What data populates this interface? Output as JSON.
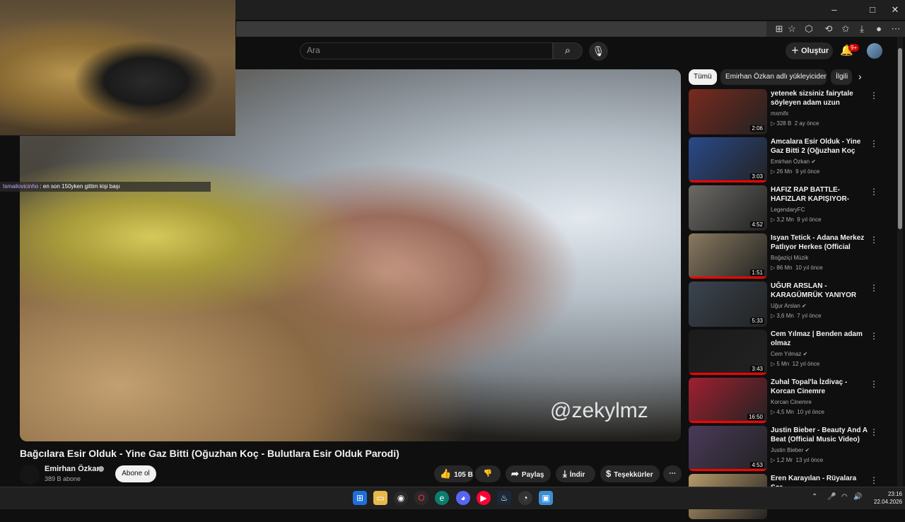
{
  "browser": {
    "controls": [
      "–",
      "□",
      "✕"
    ]
  },
  "header": {
    "search_placeholder": "Ara",
    "create_label": "Oluştur",
    "notifications_badge": "9+"
  },
  "overlay": {
    "chat_user": "Ismailovicinho",
    "chat_text": ": en son 150yken gittim kişi başı"
  },
  "video": {
    "watermark": "@zekylmz",
    "title": "Bağcılara Esir Olduk - Yine Gaz Bitti (Oğuzhan Koç - Bulutlara Esir Olduk Parodi)",
    "channel": "Emirhan Özkan",
    "subscribers": "389 B abone",
    "subscribe_label": "Abone ol",
    "likes": "105 B",
    "share_label": "Paylaş",
    "download_label": "İndir",
    "thanks_label": "Teşekkürler"
  },
  "chips": [
    "Tümü",
    "Emirhan Özkan adlı yükleyiciden",
    "İlgili"
  ],
  "recommendations": [
    {
      "title": "yetenek sizsiniz fairytale söyleyen adam uzun",
      "channel": "mxmifx",
      "views": "328 B",
      "age": "2 ay önce",
      "duration": "2:06",
      "verified": false,
      "thumb_color": "#7a2a1e"
    },
    {
      "title": "Amcalara Esir Olduk - Yine Gaz Bitti 2 (Oğuzhan Koç Parodi)",
      "channel": "Emirhan Özkan",
      "views": "26 Mn",
      "age": "9 yıl önce",
      "duration": "3:03",
      "verified": true,
      "thumb_color": "#2a4a8a"
    },
    {
      "title": "HAFIZ RAP BATTLE-HAFIZLAR KAPIŞIYOR-HAFIZ LAF ...",
      "channel": "LegendaryFC",
      "views": "3,2 Mn",
      "age": "9 yıl önce",
      "duration": "4:52",
      "verified": false,
      "thumb_color": "#6b6a66"
    },
    {
      "title": "Isyan Tetick - Adana Merkez Patlıyor Herkes (Official Video)",
      "channel": "Boğaziçi Müzik",
      "views": "86 Mn",
      "age": "10 yıl önce",
      "duration": "1:51",
      "verified": false,
      "thumb_color": "#8a7a60"
    },
    {
      "title": "UĞUR ARSLAN - KARAGÜMRÜK YANIYOR",
      "channel": "Uğur Arslan",
      "views": "3,6 Mn",
      "age": "7 yıl önce",
      "duration": "5:33",
      "verified": true,
      "thumb_color": "#3a4450"
    },
    {
      "title": "Cem Yılmaz | Benden adam olmaz",
      "channel": "Cem Yılmaz",
      "views": "5 Mn",
      "age": "12 yıl önce",
      "duration": "3:43",
      "verified": true,
      "thumb_color": "#1a1a1a"
    },
    {
      "title": "Zuhal Topal'la İzdivaç - Korcan Cinemre",
      "channel": "Korcan Cinemre",
      "views": "4,5 Mn",
      "age": "10 yıl önce",
      "duration": "16:50",
      "verified": false,
      "thumb_color": "#a02030"
    },
    {
      "title": "Justin Bieber - Beauty And A Beat (Official Music Video) ft. ...",
      "channel": "Justin Bieber",
      "views": "1,2 Mr",
      "age": "13 yıl önce",
      "duration": "4:53",
      "verified": true,
      "thumb_color": "#4a3a5a"
    },
    {
      "title": "Eren Karayılan - Rüyalara Sor",
      "channel": "",
      "views": "",
      "age": "",
      "duration": "",
      "verified": false,
      "thumb_color": "#b89a6a"
    }
  ],
  "taskbar": {
    "time": "23:16",
    "date": "22.04.2026"
  }
}
